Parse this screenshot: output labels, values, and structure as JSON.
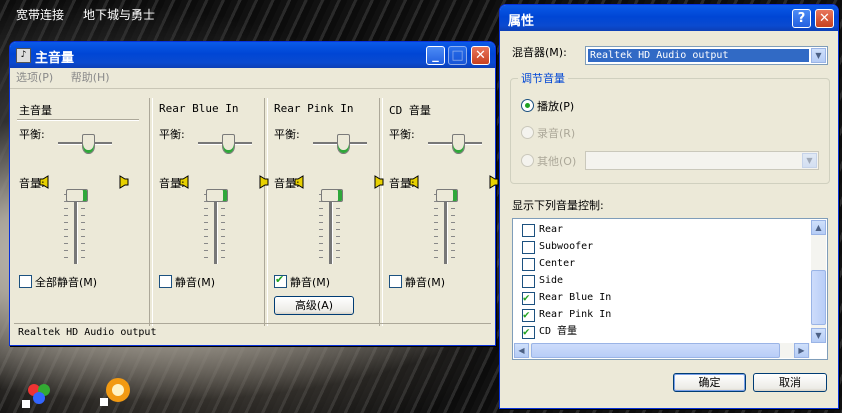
{
  "desktop": {
    "top_links": [
      "宽带连接",
      "地下城与勇士"
    ]
  },
  "mixer": {
    "title": "主音量",
    "menu": [
      "选项(P)",
      "帮助(H)"
    ],
    "columns": [
      {
        "title": "主音量",
        "balance": "平衡:",
        "volume": "音量:",
        "mute": "全部静音(M)",
        "muted": false
      },
      {
        "title": "Rear Blue In",
        "balance": "平衡:",
        "volume": "音量:",
        "mute": "静音(M)",
        "muted": false
      },
      {
        "title": "Rear Pink In",
        "balance": "平衡:",
        "volume": "音量:",
        "mute": "静音(M)",
        "muted": true,
        "advanced": "高级(A)"
      },
      {
        "title": "CD 音量",
        "balance": "平衡:",
        "volume": "音量:",
        "mute": "静音(M)",
        "muted": false
      }
    ],
    "status": "Realtek HD Audio output"
  },
  "props": {
    "title": "属性",
    "mixer_label": "混音器(M):",
    "mixer_value": "Realtek HD Audio output",
    "group_label": "调节音量",
    "radios": [
      {
        "label": "播放(P)",
        "selected": true,
        "enabled": true
      },
      {
        "label": "录音(R)",
        "selected": false,
        "enabled": false
      },
      {
        "label": "其他(O)",
        "selected": false,
        "enabled": false
      }
    ],
    "list_label": "显示下列音量控制:",
    "list": [
      {
        "label": "Rear",
        "checked": false
      },
      {
        "label": "Subwoofer",
        "checked": false
      },
      {
        "label": "Center",
        "checked": false
      },
      {
        "label": "Side",
        "checked": false
      },
      {
        "label": "Rear Blue In",
        "checked": true
      },
      {
        "label": "Rear Pink In",
        "checked": true
      },
      {
        "label": "CD 音量",
        "checked": true
      }
    ],
    "ok": "确定",
    "cancel": "取消"
  },
  "colors": {
    "title_bar": "#0a4ad0",
    "check": "#21a121",
    "slider_accent": "#2fa73a"
  }
}
